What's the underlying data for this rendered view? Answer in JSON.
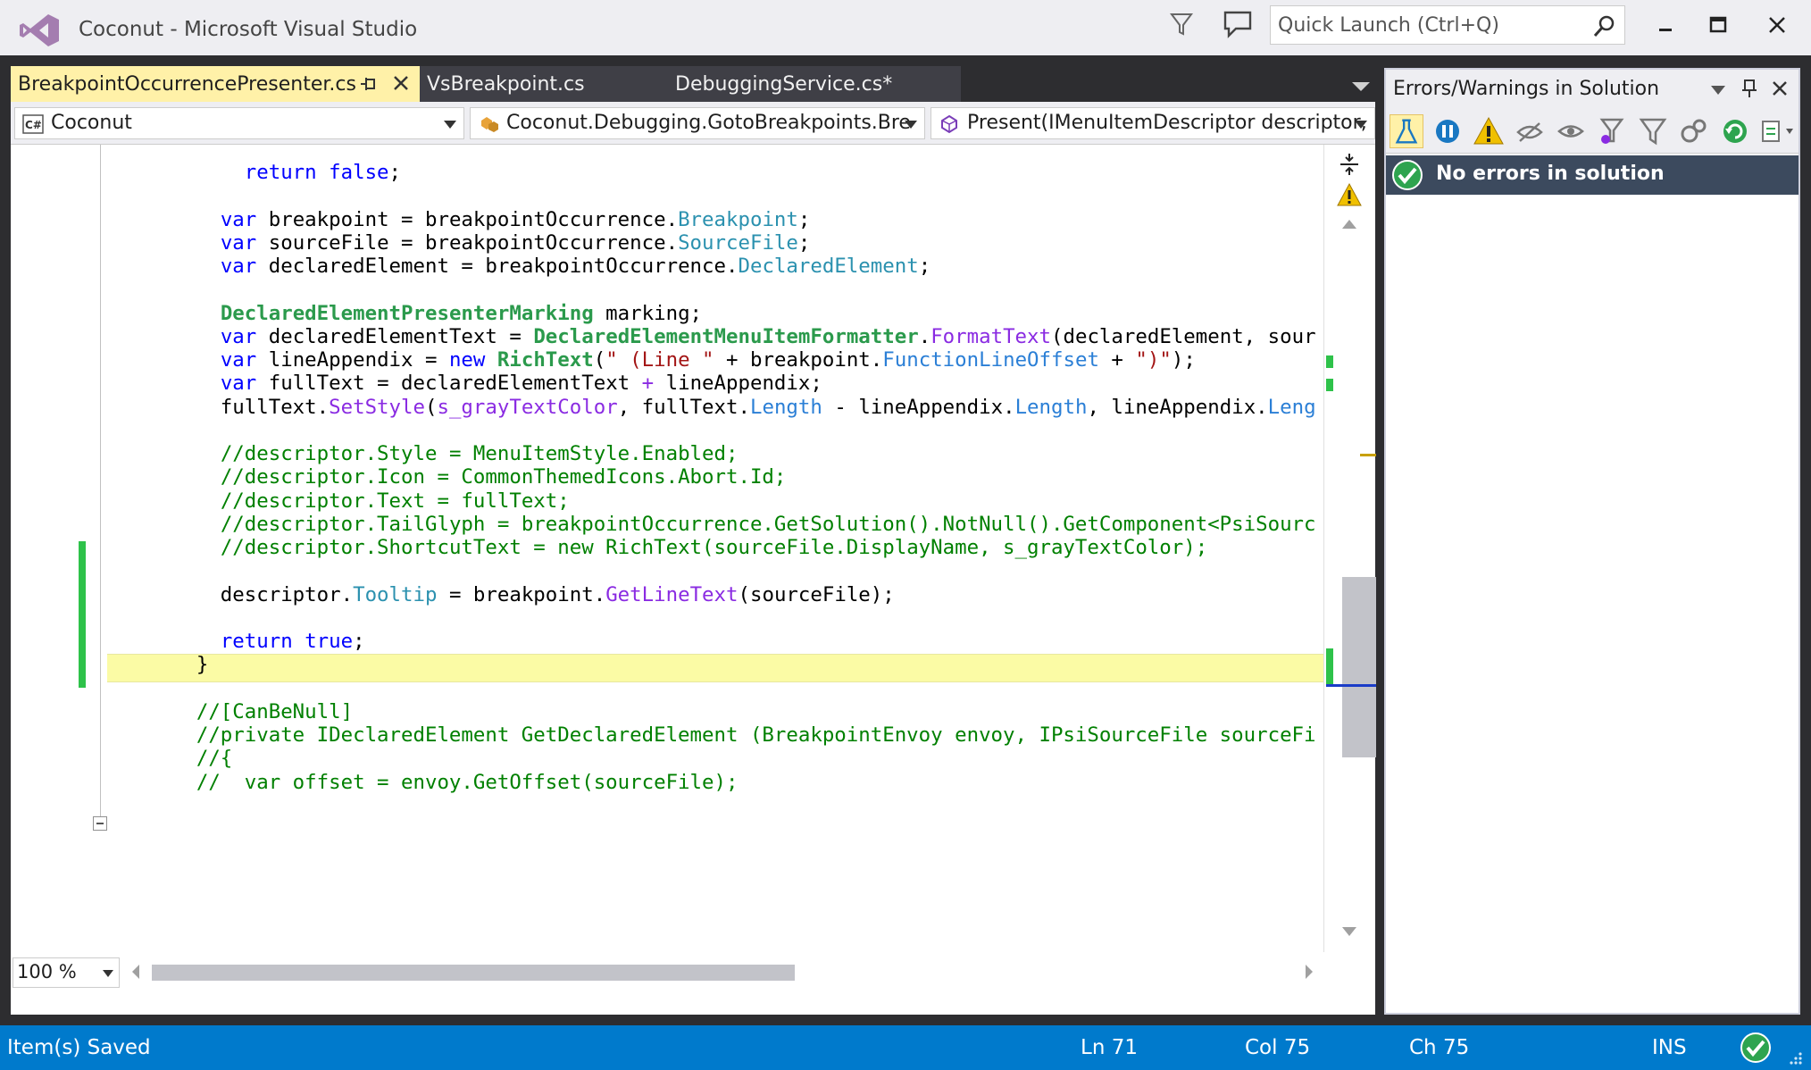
{
  "window": {
    "title": "Coconut - Microsoft Visual Studio",
    "quick_launch_placeholder": "Quick Launch (Ctrl+Q)"
  },
  "tabs": [
    {
      "label": "BreakpointOccurrencePresenter.cs",
      "active": true
    },
    {
      "label": "VsBreakpoint.cs",
      "active": false
    },
    {
      "label": "DebuggingService.cs*",
      "active": false
    }
  ],
  "navbar": {
    "project": "Coconut",
    "type": "Coconut.Debugging.GotoBreakpoints.Bre",
    "member": "Present(IMenuItemDescriptor descriptor,"
  },
  "code": [
    [
      [
        "pl",
        "            "
      ],
      [
        "kw",
        "return"
      ],
      [
        "pl",
        " "
      ],
      [
        "kw",
        "false"
      ],
      [
        "pl",
        ";"
      ]
    ],
    [],
    [
      [
        "pl",
        "          "
      ],
      [
        "kw",
        "var"
      ],
      [
        "pl",
        " breakpoint = breakpointOccurrence."
      ],
      [
        "ty",
        "Breakpoint"
      ],
      [
        "pl",
        ";"
      ]
    ],
    [
      [
        "pl",
        "          "
      ],
      [
        "kw",
        "var"
      ],
      [
        "pl",
        " sourceFile = breakpointOccurrence."
      ],
      [
        "ty",
        "SourceFile"
      ],
      [
        "pl",
        ";"
      ]
    ],
    [
      [
        "pl",
        "          "
      ],
      [
        "kw",
        "var"
      ],
      [
        "pl",
        " declaredElement = breakpointOccurrence."
      ],
      [
        "ty",
        "DeclaredElement"
      ],
      [
        "pl",
        ";"
      ]
    ],
    [],
    [
      [
        "pl",
        "          "
      ],
      [
        "tyb",
        "DeclaredElementPresenterMarking"
      ],
      [
        "pl",
        " marking;"
      ]
    ],
    [
      [
        "pl",
        "          "
      ],
      [
        "kw",
        "var"
      ],
      [
        "pl",
        " declaredElementText = "
      ],
      [
        "tyb",
        "DeclaredElementMenuItemFormatter"
      ],
      [
        "pl",
        "."
      ],
      [
        "mt",
        "FormatText"
      ],
      [
        "pl",
        "(declaredElement, sour"
      ]
    ],
    [
      [
        "pl",
        "          "
      ],
      [
        "kw",
        "var"
      ],
      [
        "pl",
        " lineAppendix = "
      ],
      [
        "kw",
        "new"
      ],
      [
        "pl",
        " "
      ],
      [
        "tyb",
        "RichText"
      ],
      [
        "pl",
        "("
      ],
      [
        "st",
        "\" (Line \""
      ],
      [
        "pl",
        " + breakpoint."
      ],
      [
        "pr",
        "FunctionLineOffset"
      ],
      [
        "pl",
        " + "
      ],
      [
        "st",
        "\")\""
      ],
      [
        "pl",
        ");"
      ]
    ],
    [
      [
        "pl",
        "          "
      ],
      [
        "kw",
        "var"
      ],
      [
        "pl",
        " fullText = declaredElementText "
      ],
      [
        "mt",
        "+"
      ],
      [
        "pl",
        " lineAppendix;"
      ]
    ],
    [
      [
        "pl",
        "          fullText."
      ],
      [
        "mt",
        "SetStyle"
      ],
      [
        "pl",
        "("
      ],
      [
        "mt",
        "s_grayTextColor"
      ],
      [
        "pl",
        ", fullText."
      ],
      [
        "pr",
        "Length"
      ],
      [
        "pl",
        " - lineAppendix."
      ],
      [
        "pr",
        "Length"
      ],
      [
        "pl",
        ", lineAppendix."
      ],
      [
        "pr",
        "Leng"
      ]
    ],
    [],
    [
      [
        "pl",
        "          "
      ],
      [
        "cm",
        "//descriptor.Style = MenuItemStyle.Enabled;"
      ]
    ],
    [
      [
        "pl",
        "          "
      ],
      [
        "cm",
        "//descriptor.Icon = CommonThemedIcons.Abort.Id;"
      ]
    ],
    [
      [
        "pl",
        "          "
      ],
      [
        "cm",
        "//descriptor.Text = fullText;"
      ]
    ],
    [
      [
        "pl",
        "          "
      ],
      [
        "cm",
        "//descriptor.TailGlyph = breakpointOccurrence.GetSolution().NotNull().GetComponent<PsiSourc"
      ]
    ],
    [
      [
        "pl",
        "          "
      ],
      [
        "cm",
        "//descriptor.ShortcutText = new RichText(sourceFile.DisplayName, s_grayTextColor);"
      ]
    ],
    [],
    [
      [
        "pl",
        "          descriptor."
      ],
      [
        "ty",
        "Tooltip"
      ],
      [
        "pl",
        " = breakpoint."
      ],
      [
        "mt",
        "GetLineText"
      ],
      [
        "pl",
        "(sourceFile);"
      ]
    ],
    [],
    [
      [
        "pl",
        "          "
      ],
      [
        "kw",
        "return"
      ],
      [
        "pl",
        " "
      ],
      [
        "kw",
        "true"
      ],
      [
        "pl",
        ";"
      ]
    ],
    [
      [
        "pl",
        "        }"
      ]
    ],
    [],
    [
      [
        "pl",
        "        "
      ],
      [
        "cm",
        "//[CanBeNull]"
      ]
    ],
    [
      [
        "pl",
        "        "
      ],
      [
        "cm",
        "//private IDeclaredElement GetDeclaredElement (BreakpointEnvoy envoy, IPsiSourceFile sourceFi"
      ]
    ],
    [
      [
        "pl",
        "        "
      ],
      [
        "cm",
        "//{"
      ]
    ],
    [
      [
        "pl",
        "        "
      ],
      [
        "cm",
        "//  var offset = envoy.GetOffset(sourceFile);"
      ]
    ]
  ],
  "zoom": "100 %",
  "errors_panel": {
    "title": "Errors/Warnings in Solution",
    "status": "No errors in solution"
  },
  "statusbar": {
    "message": "Item(s) Saved",
    "ln": "Ln 71",
    "col": "Col 75",
    "ch": "Ch 75",
    "mode": "INS"
  },
  "colors": {
    "accent": "#007acc",
    "active_tab": "#fff1a8",
    "current_line": "#fbfba5",
    "change_bar": "#2ec24a"
  }
}
